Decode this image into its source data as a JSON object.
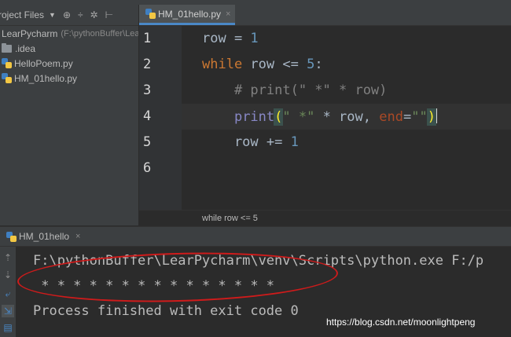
{
  "project": {
    "title": "roject Files",
    "root": {
      "name": "LearPycharm",
      "path": "(F:\\pythonBuffer\\Lea"
    },
    "items": [
      {
        "name": ".idea",
        "icon": "folder-icon"
      },
      {
        "name": "HelloPoem.py",
        "icon": "python-file-icon"
      },
      {
        "name": "HM_01hello.py",
        "icon": "python-file-icon"
      }
    ]
  },
  "editor": {
    "tab": {
      "label": "HM_01hello.py",
      "close": "×"
    },
    "line_numbers": [
      "1",
      "2",
      "3",
      "4",
      "5",
      "6"
    ],
    "lines": [
      {
        "parts": [
          {
            "t": "row = "
          },
          {
            "t": "1",
            "c": "num"
          }
        ]
      },
      {
        "parts": [
          {
            "t": "while",
            "c": "kw"
          },
          {
            "t": " row <= "
          },
          {
            "t": "5",
            "c": "num"
          },
          {
            "t": ":"
          }
        ]
      },
      {
        "parts": [
          {
            "t": "    # print(\" *\" * row)",
            "c": "cm"
          }
        ]
      },
      {
        "parts": [
          {
            "t": "    "
          },
          {
            "t": "print",
            "c": "bi"
          },
          {
            "t": "(",
            "c": "brk"
          },
          {
            "t": "\" *\"",
            "c": "str"
          },
          {
            "t": " * row, "
          },
          {
            "t": "end",
            "c": "kwarg"
          },
          {
            "t": "="
          },
          {
            "t": "\"\"",
            "c": "str"
          },
          {
            "t": ")",
            "c": "brk"
          }
        ]
      },
      {
        "parts": [
          {
            "t": "    row += "
          },
          {
            "t": "1",
            "c": "num"
          }
        ]
      },
      {
        "parts": []
      }
    ],
    "breadcrumb": "while row <= 5"
  },
  "run": {
    "tab": {
      "label": "HM_01hello",
      "close": "×"
    },
    "output": [
      "F:\\pythonBuffer\\LearPycharm\\venv\\Scripts\\python.exe F:/p",
      " * * * * * * * * * * * * * * *",
      "Process finished with exit code 0"
    ]
  },
  "watermark": "https://blog.csdn.net/moonlightpeng"
}
